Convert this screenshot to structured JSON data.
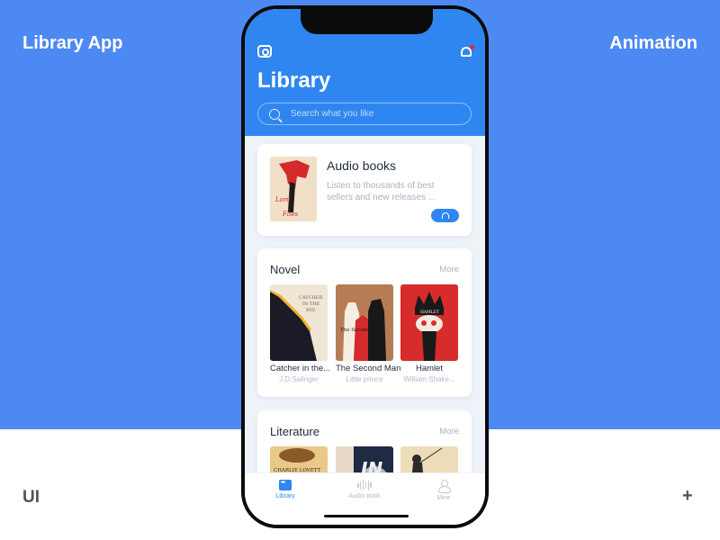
{
  "frame": {
    "top_left_label": "Library App",
    "top_right_label": "Animation",
    "bottom_left_label": "UI",
    "bottom_right_label": "+",
    "colors": {
      "background_blue": "#4d89f3",
      "accent": "#2f86f0",
      "notification_dot": "#e8243b"
    }
  },
  "header": {
    "title": "Library",
    "left_icon": "camera-icon",
    "right_icon": "bell-icon",
    "has_notification": true
  },
  "search": {
    "placeholder": "Search what you like",
    "value": ""
  },
  "audio_card": {
    "title": "Audio books",
    "description": "Listen to thousands of best sellers and new releases ...",
    "button_icon": "headphones-icon",
    "cover_title": "Lord of the Flies"
  },
  "sections": [
    {
      "title": "Novel",
      "more_label": "More",
      "books": [
        {
          "title": "Catcher in the...",
          "author": "J.D.Salinger",
          "cover_text": "CATCHER IN THE RYE"
        },
        {
          "title": "The Second Man",
          "author": "Little prince",
          "cover_text": "The Second Man"
        },
        {
          "title": "Hamlet",
          "author": "William Shake...",
          "cover_text": "HAMLET"
        }
      ]
    },
    {
      "title": "Literature",
      "more_label": "More",
      "books": [
        {
          "title": "",
          "author": "",
          "cover_text": "CHARLIE LOVETT"
        },
        {
          "title": "",
          "author": "",
          "cover_text": "IN"
        },
        {
          "title": "",
          "author": "",
          "cover_text": ""
        }
      ]
    }
  ],
  "tabbar": {
    "tabs": [
      {
        "label": "Library",
        "icon": "library-icon",
        "active": true
      },
      {
        "label": "Audio book",
        "icon": "soundwave-icon",
        "active": false
      },
      {
        "label": "Mine",
        "icon": "user-icon",
        "active": false
      }
    ]
  }
}
